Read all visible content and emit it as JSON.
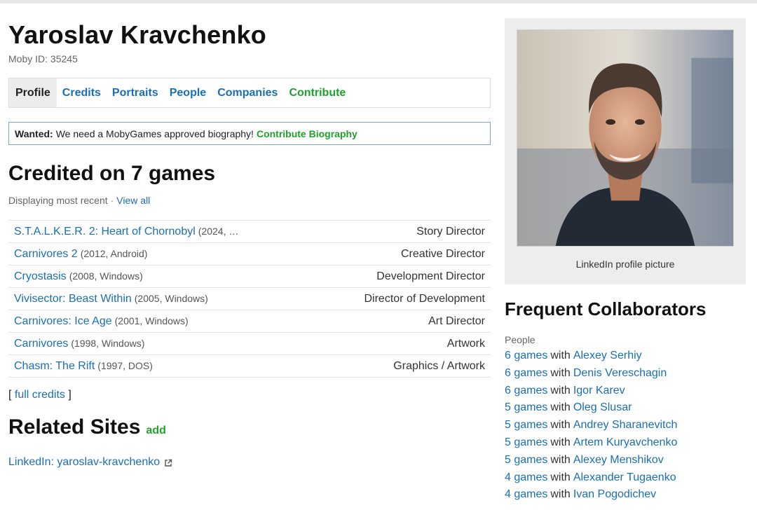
{
  "person": {
    "name": "Yaroslav Kravchenko",
    "moby_id": "Moby ID: 35245"
  },
  "tabs": [
    {
      "label": "Profile"
    },
    {
      "label": "Credits"
    },
    {
      "label": "Portraits"
    },
    {
      "label": "People"
    },
    {
      "label": "Companies"
    },
    {
      "label": "Contribute"
    }
  ],
  "wanted": {
    "prefix": "Wanted:",
    "text": "We need a MobyGames approved biography!",
    "link": "Contribute Biography"
  },
  "credited": {
    "title": "Credited on 7 games",
    "displaying": "Displaying most recent",
    "separator": "·",
    "view_all": "View all",
    "rows": [
      {
        "game": "S.T.A.L.K.E.R. 2: Heart of Chornobyl",
        "meta": "(2024, …",
        "role": "Story Director"
      },
      {
        "game": "Carnivores 2",
        "meta": "(2012, Android)",
        "role": "Creative Director"
      },
      {
        "game": "Cryostasis",
        "meta": "(2008, Windows)",
        "role": "Development Director"
      },
      {
        "game": "Vivisector: Beast Within",
        "meta": "(2005, Windows)",
        "role": "Director of Development"
      },
      {
        "game": "Carnivores: Ice Age",
        "meta": "(2001, Windows)",
        "role": "Art Director"
      },
      {
        "game": "Carnivores",
        "meta": "(1998, Windows)",
        "role": "Artwork"
      },
      {
        "game": "Chasm: The Rift",
        "meta": "(1997, DOS)",
        "role": "Graphics / Artwork"
      }
    ],
    "full_credits_open": "[",
    "full_credits": "full credits",
    "full_credits_close": "]"
  },
  "related": {
    "title": "Related Sites",
    "add": "add",
    "link": "LinkedIn: yaroslav-kravchenko",
    "icon": "external-link-icon"
  },
  "photo": {
    "caption": "LinkedIn profile picture"
  },
  "collaborators": {
    "title": "Frequent Collaborators",
    "subtitle": "People",
    "with_word": "with",
    "items": [
      {
        "games": "6 games",
        "name": "Alexey Serhiy"
      },
      {
        "games": "6 games",
        "name": "Denis Vereschagin"
      },
      {
        "games": "6 games",
        "name": "Igor Karev"
      },
      {
        "games": "5 games",
        "name": "Oleg Slusar"
      },
      {
        "games": "5 games",
        "name": "Andrey Sharanevitch"
      },
      {
        "games": "5 games",
        "name": "Artem Kuryavchenko"
      },
      {
        "games": "5 games",
        "name": "Alexey Menshikov"
      },
      {
        "games": "4 games",
        "name": "Alexander Tugaenko"
      },
      {
        "games": "4 games",
        "name": "Ivan Pogodichev"
      }
    ]
  },
  "colors": {
    "link": "#1a6fb5",
    "contribute_green": "#1fa12c",
    "panel_gray": "#ededed"
  }
}
